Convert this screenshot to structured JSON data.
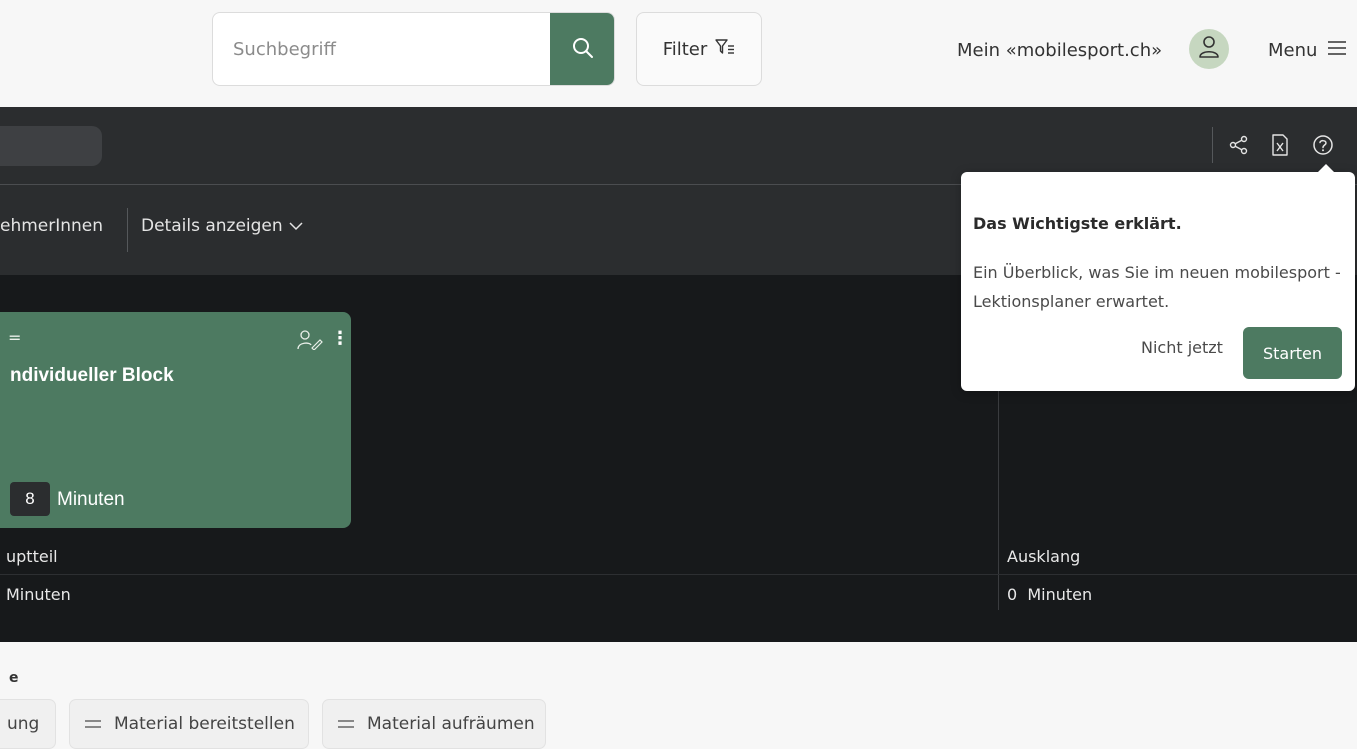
{
  "header": {
    "search_placeholder": "Suchbegriff",
    "filter_label": "Filter",
    "account_label": "Mein «mobilesport.ch»",
    "menu_label": "Menu"
  },
  "subbar": {
    "participants_label": "ehmerInnen",
    "details_label": "Details anzeigen"
  },
  "block": {
    "title": "ndividueller Block",
    "minutes_value": "8",
    "minutes_unit": "Minuten"
  },
  "phases": [
    {
      "name": "uptteil",
      "duration": "Minuten"
    },
    {
      "name": "Ausklang",
      "duration": "0  Minuten"
    }
  ],
  "bottom": {
    "section_letter": "e",
    "chips": [
      {
        "label": "ung"
      },
      {
        "label": "Material bereitstellen"
      },
      {
        "label": "Material aufräumen"
      }
    ]
  },
  "popover": {
    "title": "Das Wichtigste erklärt.",
    "body": "Ein Überblick, was Sie im neuen mobilesport - Lektionsplaner erwartet.",
    "skip_label": "Nicht jetzt",
    "start_label": "Starten"
  },
  "colors": {
    "accent_green": "#4d7a61",
    "dark_bg": "#17191b",
    "toolbar_bg": "#2b2d2f",
    "avatar_bg": "#c6d7c0"
  },
  "icons": [
    "search-icon",
    "filter-icon",
    "user-icon",
    "menu-icon",
    "share-icon",
    "excel-export-icon",
    "help-icon",
    "chevron-down-icon",
    "drag-handle-icon",
    "assign-person-icon",
    "more-vertical-icon"
  ]
}
